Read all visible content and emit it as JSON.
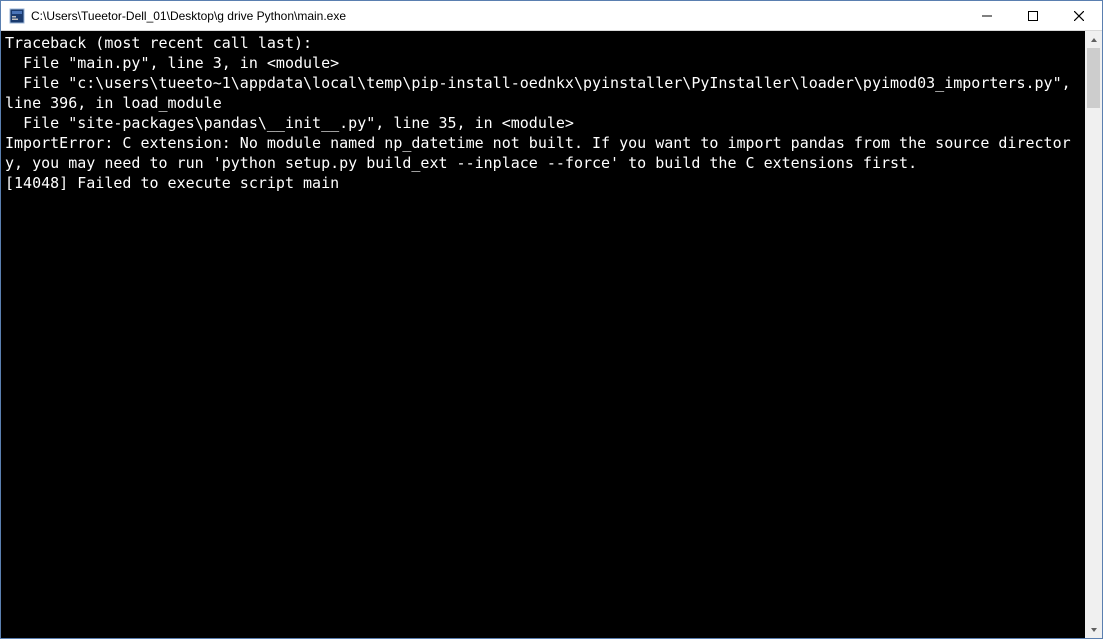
{
  "window": {
    "title": "C:\\Users\\Tueetor-Dell_01\\Desktop\\g drive Python\\main.exe"
  },
  "controls": {
    "minimize": "Minimize",
    "maximize": "Maximize",
    "close": "Close"
  },
  "console": {
    "lines": [
      "Traceback (most recent call last):",
      "  File \"main.py\", line 3, in <module>",
      "  File \"c:\\users\\tueeto~1\\appdata\\local\\temp\\pip-install-oednkx\\pyinstaller\\PyInstaller\\loader\\pyimod03_importers.py\", line 396, in load_module",
      "  File \"site-packages\\pandas\\__init__.py\", line 35, in <module>",
      "ImportError: C extension: No module named np_datetime not built. If you want to import pandas from the source directory, you may need to run 'python setup.py build_ext --inplace --force' to build the C extensions first.",
      "[14048] Failed to execute script main"
    ]
  }
}
